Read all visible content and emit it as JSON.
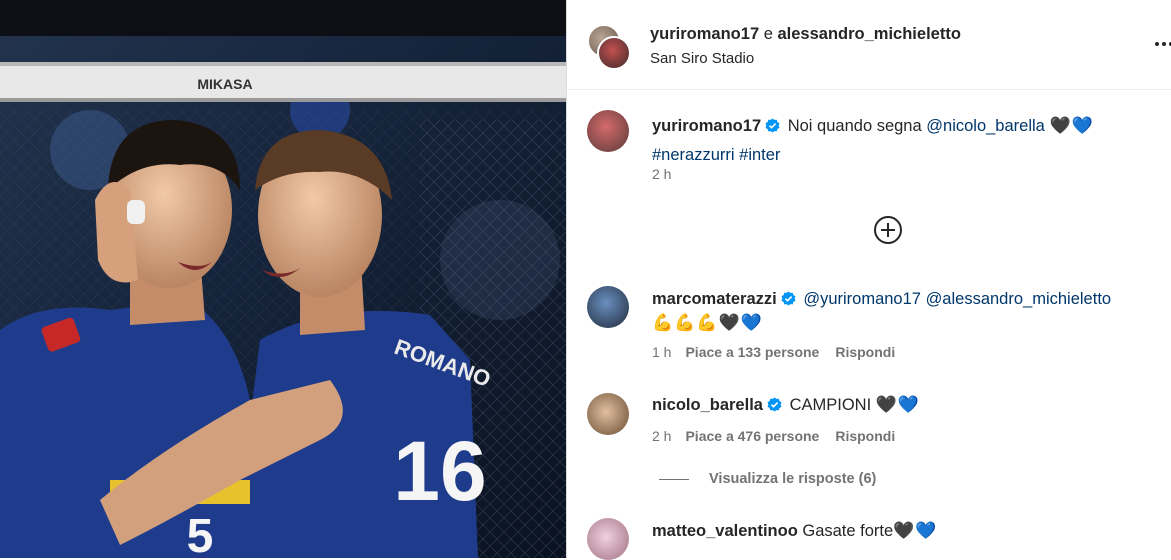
{
  "header": {
    "user1": "yuriromano17",
    "conjunction": "e",
    "user2": "alessandro_michieletto",
    "location": "San Siro Stadio",
    "more_icon": "more-horizontal-icon"
  },
  "photo": {
    "net_brand": "MIKASA",
    "jersey_name": "ROMANO",
    "jersey_number": "16",
    "front_number": "5"
  },
  "caption": {
    "username": "yuriromano17",
    "text_before": "Noi quando segna",
    "mention": "@nicolo_barella",
    "emojis": "🖤💙",
    "hashtag1": "#nerazzurri",
    "hashtag2": "#inter",
    "time": "2 h"
  },
  "load_more_icon": "add-circle-icon",
  "comments": [
    {
      "username": "marcomaterazzi",
      "mention1": "@yuriromano17",
      "mention2": "@alessandro_michieletto",
      "emojis_flex": "💪💪💪",
      "emojis_hearts": "🖤💙",
      "time": "1 h",
      "likes": "Piace a 133 persone",
      "reply": "Rispondi"
    },
    {
      "username": "nicolo_barella",
      "text": "CAMPIONI",
      "emojis_hearts": "🖤💙",
      "time": "2 h",
      "likes": "Piace a 476 persone",
      "reply": "Rispondi",
      "view_replies": "Visualizza le risposte (6)"
    },
    {
      "username": "matteo_valentinoo",
      "text": "Gasate forte",
      "emojis_hearts": "🖤💙"
    }
  ],
  "colors": {
    "verified": "#0095f6",
    "link": "#00376b",
    "secondary": "#737373",
    "italy_blue": "#1f3c8c"
  }
}
